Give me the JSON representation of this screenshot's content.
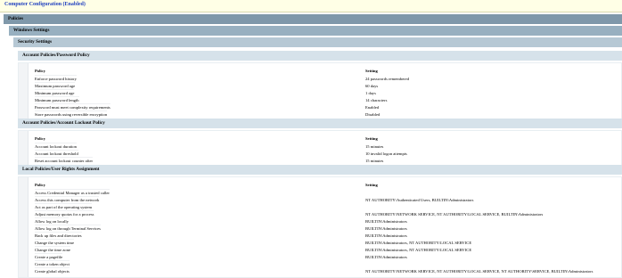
{
  "computer_config": {
    "title": "Computer Configuration (Enabled)"
  },
  "levels": {
    "policies": "Policies",
    "windows_settings": "Windows Settings",
    "security_settings": "Security Settings"
  },
  "columns": {
    "policy": "Policy",
    "setting": "Setting"
  },
  "sections": [
    {
      "title": "Account Policies/Password Policy",
      "rows": [
        {
          "policy": "Enforce password history",
          "setting": "24 passwords remembered"
        },
        {
          "policy": "Maximum password age",
          "setting": "60 days"
        },
        {
          "policy": "Minimum password age",
          "setting": "1 days"
        },
        {
          "policy": "Minimum password length",
          "setting": "14 characters"
        },
        {
          "policy": "Password must meet complexity requirements",
          "setting": "Enabled"
        },
        {
          "policy": "Store passwords using reversible encryption",
          "setting": "Disabled"
        }
      ]
    },
    {
      "title": "Account Policies/Account Lockout Policy",
      "rows": [
        {
          "policy": "Account lockout duration",
          "setting": "15 minutes"
        },
        {
          "policy": "Account lockout threshold",
          "setting": "10 invalid logon attempts"
        },
        {
          "policy": "Reset account lockout counter after",
          "setting": "15 minutes"
        }
      ]
    },
    {
      "title": "Local Policies/User Rights Assignment",
      "rows": [
        {
          "policy": "Access Credential Manager as a trusted caller",
          "setting": ""
        },
        {
          "policy": "Access this computer from the network",
          "setting": "NT AUTHORITY\\Authenticated Users, BUILTIN\\Administrators"
        },
        {
          "policy": "Act as part of the operating system",
          "setting": ""
        },
        {
          "policy": "Adjust memory quotas for a process",
          "setting": "NT AUTHORITY\\NETWORK SERVICE, NT AUTHORITY\\LOCAL SERVICE, BUILTIN\\Administrators"
        },
        {
          "policy": "Allow log on locally",
          "setting": "BUILTIN\\Administrators"
        },
        {
          "policy": "Allow log on through Terminal Services",
          "setting": "BUILTIN\\Administrators"
        },
        {
          "policy": "Back up files and directories",
          "setting": "BUILTIN\\Administrators"
        },
        {
          "policy": "Change the system time",
          "setting": "BUILTIN\\Administrators, NT AUTHORITY\\LOCAL SERVICE"
        },
        {
          "policy": "Change the time zone",
          "setting": "BUILTIN\\Administrators, NT AUTHORITY\\LOCAL SERVICE"
        },
        {
          "policy": "Create a pagefile",
          "setting": "BUILTIN\\Administrators"
        },
        {
          "policy": "Create a token object",
          "setting": ""
        },
        {
          "policy": "Create global objects",
          "setting": "NT AUTHORITY\\NETWORK SERVICE, NT AUTHORITY\\LOCAL SERVICE, NT AUTHORITY\\SERVICE, BUILTIN\\Administrators"
        }
      ]
    }
  ]
}
